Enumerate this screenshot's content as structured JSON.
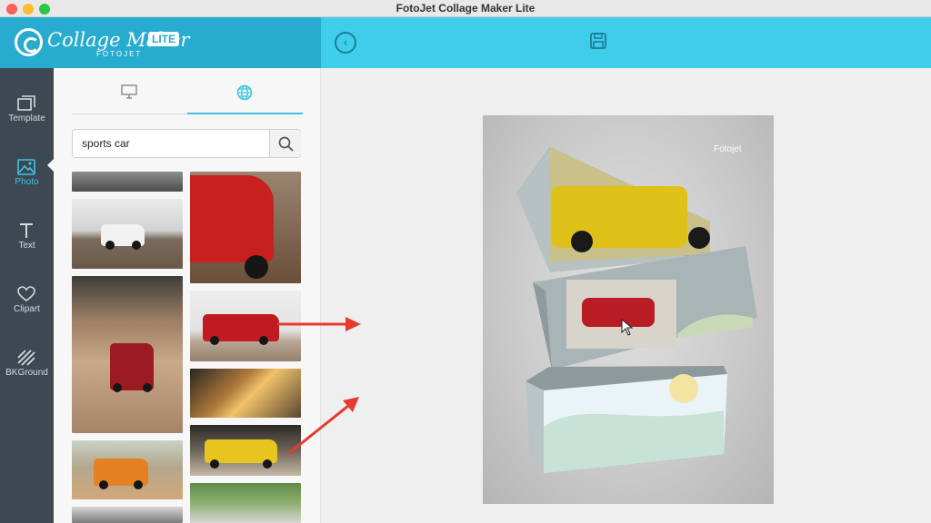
{
  "window": {
    "title": "FotoJet Collage Maker Lite"
  },
  "brand": {
    "name": "Collage Maker",
    "badge": "LITE",
    "sub": "FOTOJET"
  },
  "toolbar": {
    "back_icon": "back-arrow-circle-icon",
    "save_icon": "save-disk-icon"
  },
  "sidebar": {
    "items": [
      {
        "label": "Template",
        "icon": "template-icon"
      },
      {
        "label": "Photo",
        "icon": "photo-icon"
      },
      {
        "label": "Text",
        "icon": "text-icon"
      },
      {
        "label": "Clipart",
        "icon": "heart-icon"
      },
      {
        "label": "BKGround",
        "icon": "background-icon"
      }
    ],
    "active": "Photo"
  },
  "panel": {
    "tabs": [
      {
        "icon": "computer-icon"
      },
      {
        "icon": "globe-icon"
      }
    ],
    "active_tab": "globe",
    "search": {
      "value": "sports car",
      "icon": "search-icon"
    }
  },
  "canvas": {
    "watermark": "Fotojet"
  },
  "colors": {
    "accent": "#39c6e6",
    "appbar": "#3ecdea",
    "logo_bg": "#27acd0",
    "sidebar": "#3d4852",
    "arrow": "#e63b2e"
  }
}
